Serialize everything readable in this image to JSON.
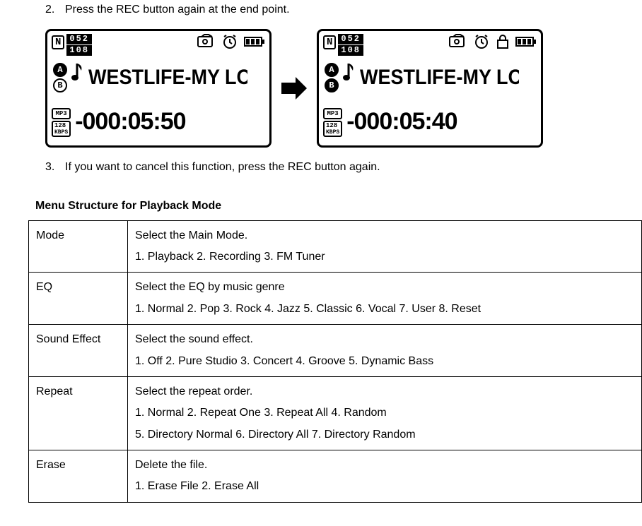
{
  "steps": [
    {
      "num": "2.",
      "text": "Press the REC button again at the end point."
    },
    {
      "num": "3.",
      "text": "If you want to cancel this function, press the REC button again."
    }
  ],
  "lcd": {
    "n_label": "N",
    "track_current": "052",
    "track_total": "108",
    "ab_a": "A",
    "ab_b": "B",
    "song": "WESTLIFE-MY LO",
    "fmt": "MP3",
    "bitrate1": "128",
    "bitrate2": "KBPS",
    "time_left": "-000:05:50",
    "time_right": "-000:05:40"
  },
  "section_title": "Menu Structure for Playback Mode",
  "menu": [
    {
      "label": "Mode",
      "lines": [
        "Select the Main Mode.",
        "1. Playback 2. Recording 3. FM Tuner"
      ]
    },
    {
      "label": "EQ",
      "lines": [
        "Select the EQ by music genre",
        "1. Normal 2. Pop 3. Rock 4. Jazz 5. Classic 6. Vocal 7. User 8. Reset"
      ]
    },
    {
      "label": "Sound Effect",
      "lines": [
        "Select the sound effect.",
        "1. Off 2. Pure Studio 3. Concert 4. Groove 5. Dynamic Bass"
      ]
    },
    {
      "label": "Repeat",
      "lines": [
        "Select the repeat order.",
        "1. Normal 2. Repeat One 3. Repeat All 4. Random",
        "5. Directory Normal 6. Directory All 7. Directory Random"
      ]
    },
    {
      "label": "Erase",
      "lines": [
        "Delete the file.",
        "1. Erase File 2. Erase All"
      ]
    }
  ]
}
